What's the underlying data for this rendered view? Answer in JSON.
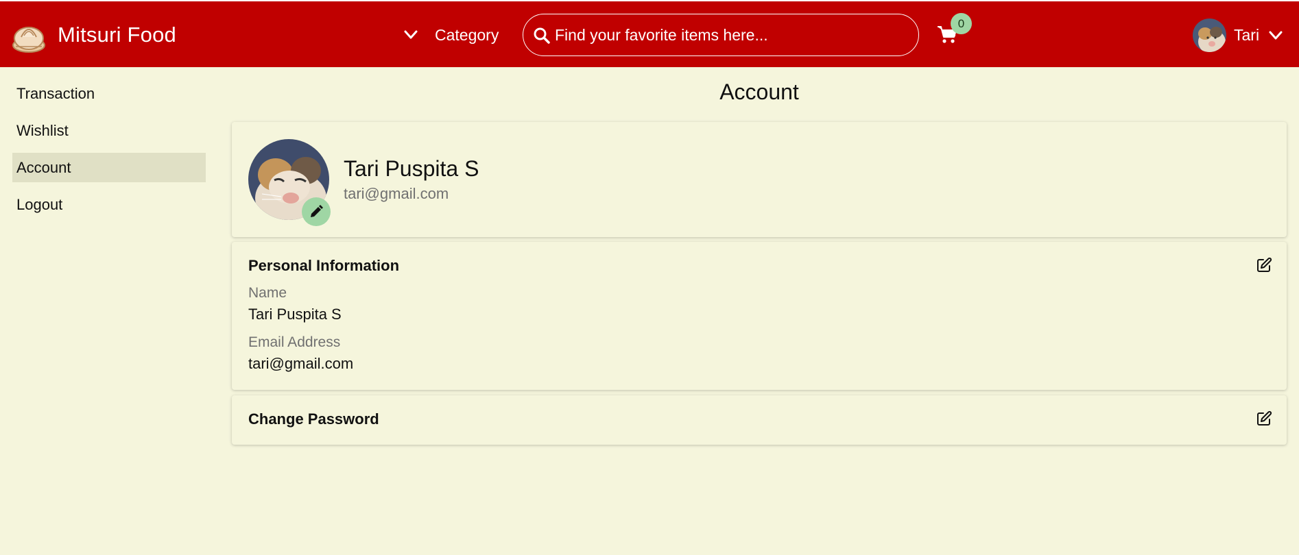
{
  "header": {
    "brand": "Mitsuri Food",
    "category_label": "Category",
    "search_placeholder": "Find your favorite items here...",
    "cart_count": "0",
    "user_name": "Tari",
    "bg_color": "#c00000",
    "badge_color": "#9fd6a4"
  },
  "sidebar": {
    "items": [
      {
        "label": "Transaction",
        "active": false
      },
      {
        "label": "Wishlist",
        "active": false
      },
      {
        "label": "Account",
        "active": true
      },
      {
        "label": "Logout",
        "active": false
      }
    ]
  },
  "main": {
    "title": "Account",
    "profile": {
      "name": "Tari Puspita S",
      "email": "tari@gmail.com"
    },
    "personal_info": {
      "title": "Personal Information",
      "name_label": "Name",
      "name_value": "Tari Puspita S",
      "email_label": "Email Address",
      "email_value": "tari@gmail.com"
    },
    "change_password": {
      "title": "Change Password"
    }
  },
  "icons": [
    "logo-icon",
    "chevron-down-icon",
    "search-icon",
    "cart-icon",
    "pencil-icon",
    "edit-square-icon"
  ],
  "colors": {
    "page_bg": "#f5f5dc",
    "active_item_bg": "#e0e0c5"
  }
}
